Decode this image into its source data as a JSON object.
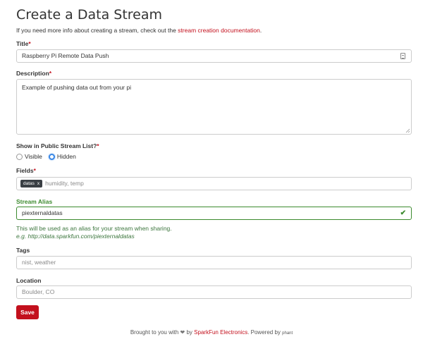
{
  "page": {
    "title": "Create a Data Stream",
    "intro_text": "If you need more info about creating a stream, check out the ",
    "intro_link": "stream creation documentation",
    "intro_end": "."
  },
  "form": {
    "title": {
      "label": "Title",
      "required": "*",
      "value": "Raspberry Pi Remote Data Push"
    },
    "description": {
      "label": "Description",
      "required": "*",
      "value": "Example of pushing data out from your pi"
    },
    "visibility": {
      "label": "Show in Public Stream List?",
      "required": "*",
      "options": [
        "Visible",
        "Hidden"
      ],
      "selected": "Hidden"
    },
    "fields": {
      "label": "Fields",
      "required": "*",
      "chip": "datas",
      "chip_remove": "x",
      "placeholder": "humidity, temp"
    },
    "alias": {
      "label": "Stream Alias",
      "value": "piexternaldatas",
      "help": "This will be used as an alias for your stream when sharing.",
      "example": "e.g. http://data.sparkfun.com/piexternaldatas",
      "status_color": "#3c8a2e"
    },
    "tags": {
      "label": "Tags",
      "placeholder": "nist, weather"
    },
    "location": {
      "label": "Location",
      "placeholder": "Boulder, CO"
    },
    "save_label": "Save"
  },
  "footer": {
    "prefix": "Brought to you with",
    "by": "by",
    "brand": "SparkFun Electronics",
    "powered": ". Powered by",
    "engine": "phant"
  },
  "colors": {
    "accent": "#c3101d",
    "success": "#3c8a2e",
    "radio_selected": "#3b88e6"
  }
}
